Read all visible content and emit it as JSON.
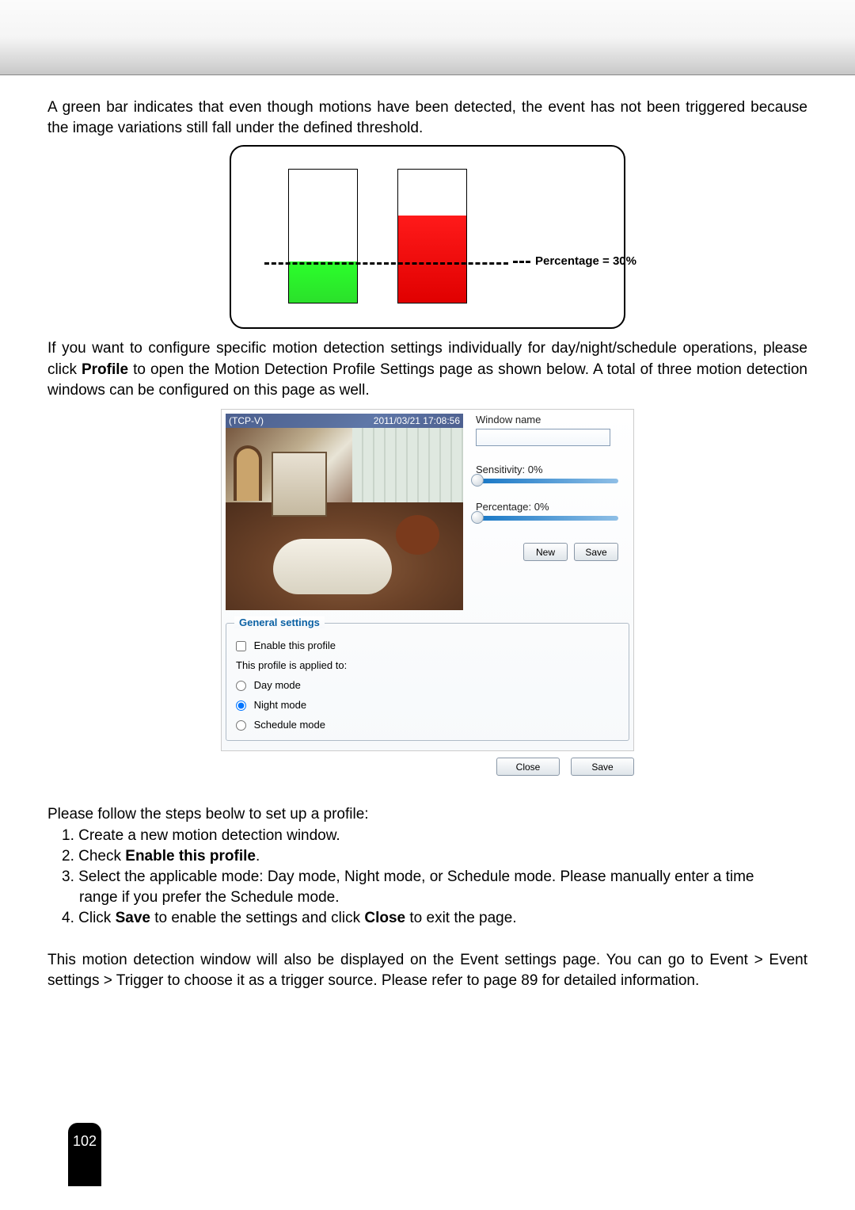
{
  "intro1": "A green bar indicates that even though motions have been detected, the event has not been triggered because the image variations still fall under the defined threshold.",
  "diagram_label": "Percentage = 30%",
  "intro2a": "If you want to configure specific motion detection settings individually for day/night/schedule operations, please click ",
  "intro2b": "Profile",
  "intro2c": " to open the Motion Detection Profile Settings page as shown below. A total of three motion detection windows can be configured on this page as well.",
  "video": {
    "tcp": "(TCP-V)",
    "ts": "2011/03/21 17:08:56"
  },
  "side": {
    "wname": "Window name",
    "sens": "Sensitivity: 0%",
    "perc": "Percentage: 0%",
    "new": "New",
    "save": "Save"
  },
  "fs": {
    "legend": "General settings",
    "enable": "Enable this profile",
    "applied": "This profile is applied to:",
    "day": "Day mode",
    "night": "Night mode",
    "sched": "Schedule mode"
  },
  "btns": {
    "close": "Close",
    "save": "Save"
  },
  "steps_intro": "Please follow the steps beolw to set up a profile:",
  "s1": "1. Create a new motion detection window.",
  "s2a": "2. Check ",
  "s2b": "Enable this profile",
  "s2c": ".",
  "s3a": "3. Select the applicable mode: Day mode, Night mode, or Schedule mode. Please manually enter a time",
  "s3b": "range if you prefer the Schedule mode.",
  "s4a": "4. Click ",
  "s4b": "Save",
  "s4c": " to enable the settings and click ",
  "s4d": "Close",
  "s4e": " to exit the page.",
  "post": "This motion detection window will also be displayed on the Event settings page. You can go to Event > Event settings > Trigger to choose it as a trigger source. Please refer to page 89 for detailed information.",
  "page": "102"
}
